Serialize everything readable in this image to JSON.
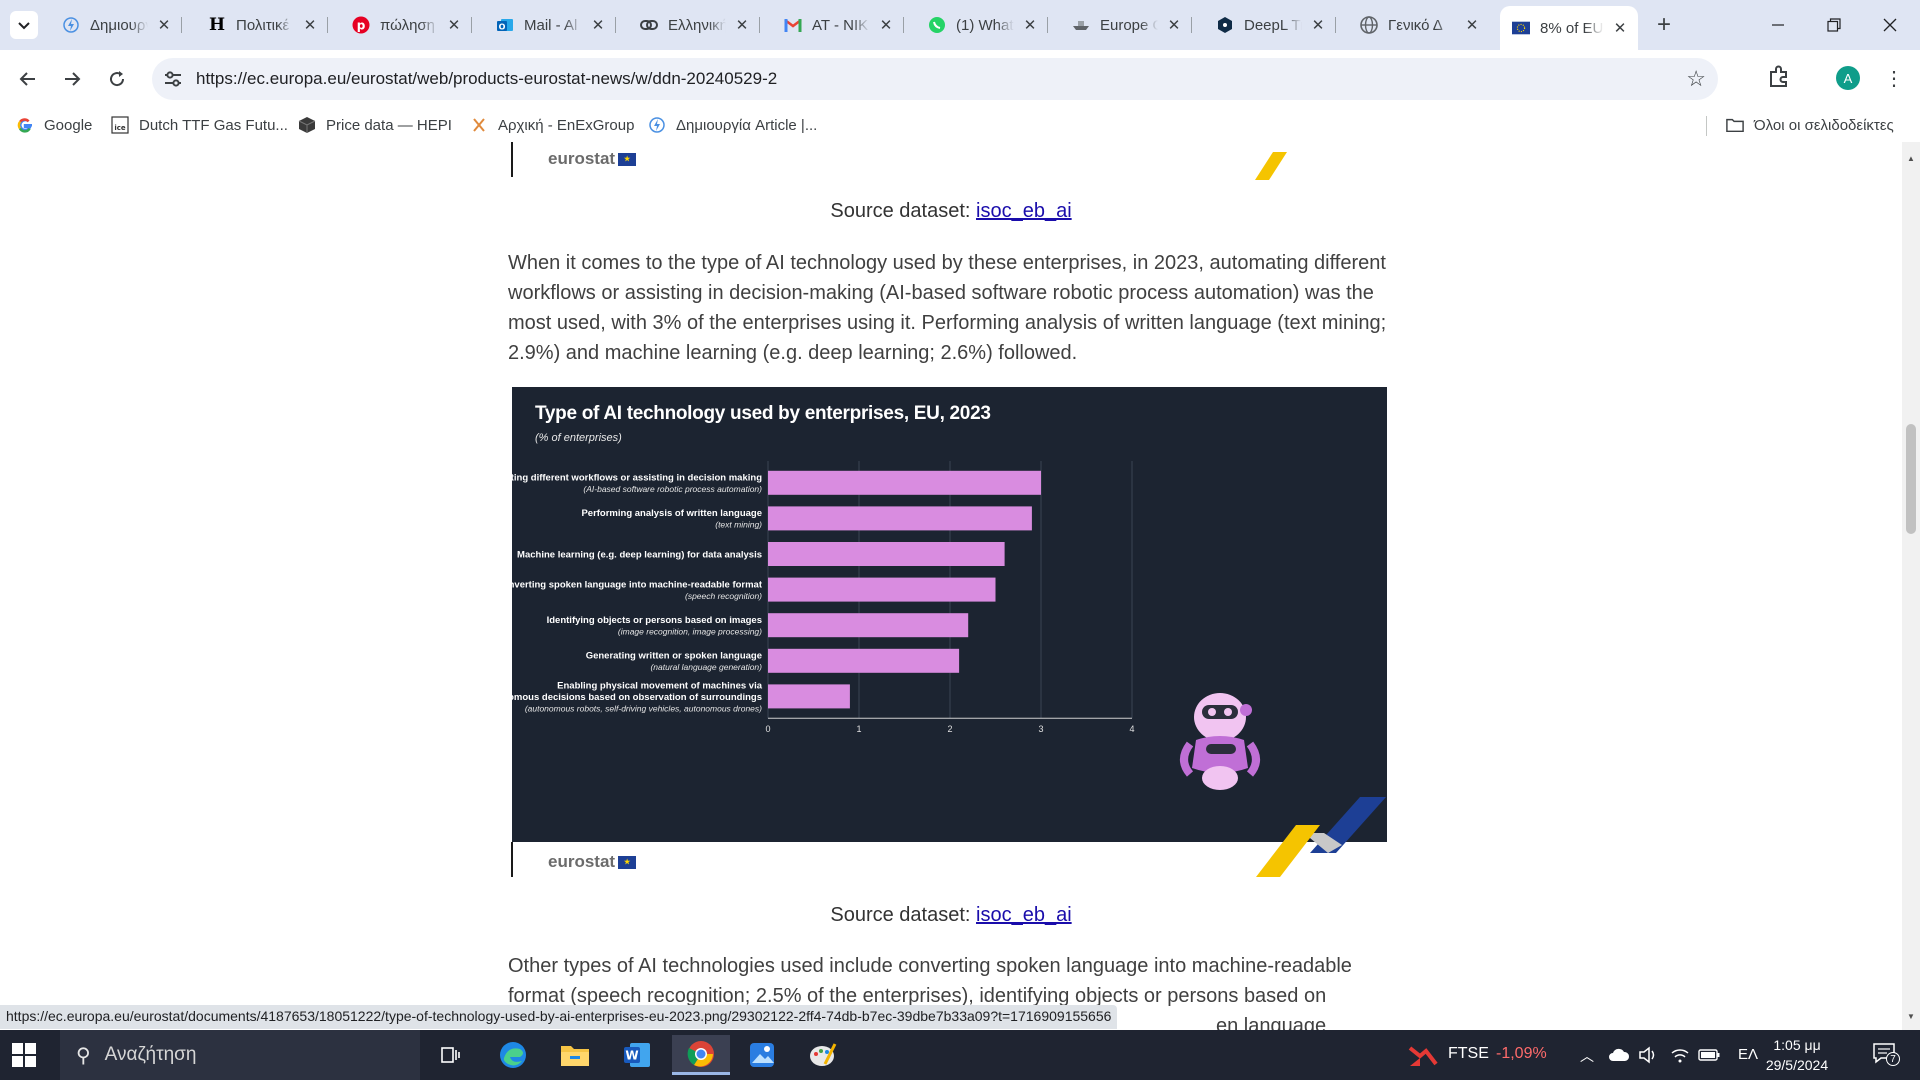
{
  "browser": {
    "tabs": [
      {
        "title": "Δημιουργ",
        "icon": "lightning-icon"
      },
      {
        "title": "Πολιτικέ",
        "icon": "h-letter-icon"
      },
      {
        "title": "πώληση",
        "icon": "pinterest-icon"
      },
      {
        "title": "Mail - Al",
        "icon": "outlook-icon"
      },
      {
        "title": "Ελληνική",
        "icon": "link-icon"
      },
      {
        "title": "AT - NIK",
        "icon": "gmail-icon"
      },
      {
        "title": "(1) What",
        "icon": "whatsapp-icon"
      },
      {
        "title": "Europe G",
        "icon": "ship-icon"
      },
      {
        "title": "DeepL Tr",
        "icon": "deepl-icon"
      },
      {
        "title": "Γενικό Δ",
        "icon": "globe-icon"
      },
      {
        "title": "8% of EU",
        "icon": "eu-flag-icon",
        "active": true
      }
    ],
    "url": "https://ec.europa.eu/eurostat/web/products-eurostat-news/w/ddn-20240529-2",
    "profile_initial": "A",
    "bookmarks": [
      {
        "label": "Google",
        "icon": "google-icon"
      },
      {
        "label": "Dutch TTF Gas Futu...",
        "icon": "ice-icon"
      },
      {
        "label": "Price data — HEPI",
        "icon": "cube-icon"
      },
      {
        "label": "Αρχική - EnExGroup",
        "icon": "enex-icon"
      },
      {
        "label": "Δημιουργία Article |...",
        "icon": "lightning-icon"
      }
    ],
    "bookmarks_folder": "Όλοι οι σελιδοδείκτες",
    "status_url": "https://ec.europa.eu/eurostat/documents/4187653/18051222/type-of-technology-used-by-ai-enterprises-eu-2023.png/29302122-2ff4-74db-b7ec-39dbe7b33a09?t=1716909155656"
  },
  "page": {
    "logo_text": "eurostat",
    "caption_prefix": "Source dataset: ",
    "caption_link": "isoc_eb_ai",
    "paragraph1": "When it comes to the type of AI technology used by these enterprises, in 2023, automating different workflows or assisting in decision-making (AI-based software robotic process automation) was the most used, with 3% of the enterprises using it. Performing analysis of written language (text mining; 2.9%) and machine learning (e.g. deep learning; 2.6%) followed.",
    "paragraph2": "Other types of AI technologies used include converting spoken language into machine-readable format (speech recognition; 2.5% of the enterprises), identifying objects or persons based on",
    "paragraph2_tail": "en language"
  },
  "chart_data": {
    "type": "bar",
    "orientation": "horizontal",
    "title": "Type of AI technology used by enterprises, EU, 2023",
    "subtitle": "(% of enterprises)",
    "categories": [
      {
        "label": [
          "Automating different workflows or assisting in decision making"
        ],
        "sub": "(AI-based software robotic process automation)"
      },
      {
        "label": [
          "Performing analysis of written language"
        ],
        "sub": "(text mining)"
      },
      {
        "label": [
          "Machine learning (e.g. deep learning) for data analysis"
        ],
        "sub": ""
      },
      {
        "label": [
          "Converting spoken language into machine-readable format"
        ],
        "sub": "(speech recognition)"
      },
      {
        "label": [
          "Identifying objects or persons based on images"
        ],
        "sub": "(image recognition, image processing)"
      },
      {
        "label": [
          "Generating written or spoken language"
        ],
        "sub": "(natural language generation)"
      },
      {
        "label": [
          "Enabling physical movement of machines via",
          "autonomous decisions based on observation of surroundings"
        ],
        "sub": "(autonomous robots, self-driving vehicles, autonomous drones)"
      }
    ],
    "values": [
      3.0,
      2.9,
      2.6,
      2.5,
      2.2,
      2.1,
      0.9
    ],
    "xlim": [
      0,
      4
    ],
    "xticks": [
      0,
      1,
      2,
      3,
      4
    ],
    "bar_color": "#d98ce0",
    "background": "#1c2431",
    "grid": true,
    "mascot_icon": "robot-icon"
  },
  "taskbar": {
    "search_placeholder": "Αναζήτηση",
    "apps": [
      "task-view-icon",
      "edge-icon",
      "file-explorer-icon",
      "word-icon",
      "chrome-icon",
      "photos-icon",
      "paint-icon"
    ],
    "ticker_name": "FTSE",
    "ticker_change": "-1,09%",
    "language": "ΕΛ",
    "time": "1:05 μμ",
    "date": "29/5/2024",
    "notification_count": "7"
  },
  "colors": {
    "link": "#1a0dab",
    "ticker_negative": "#ff6b6b",
    "chrome_frame": "#dfe5f3"
  }
}
